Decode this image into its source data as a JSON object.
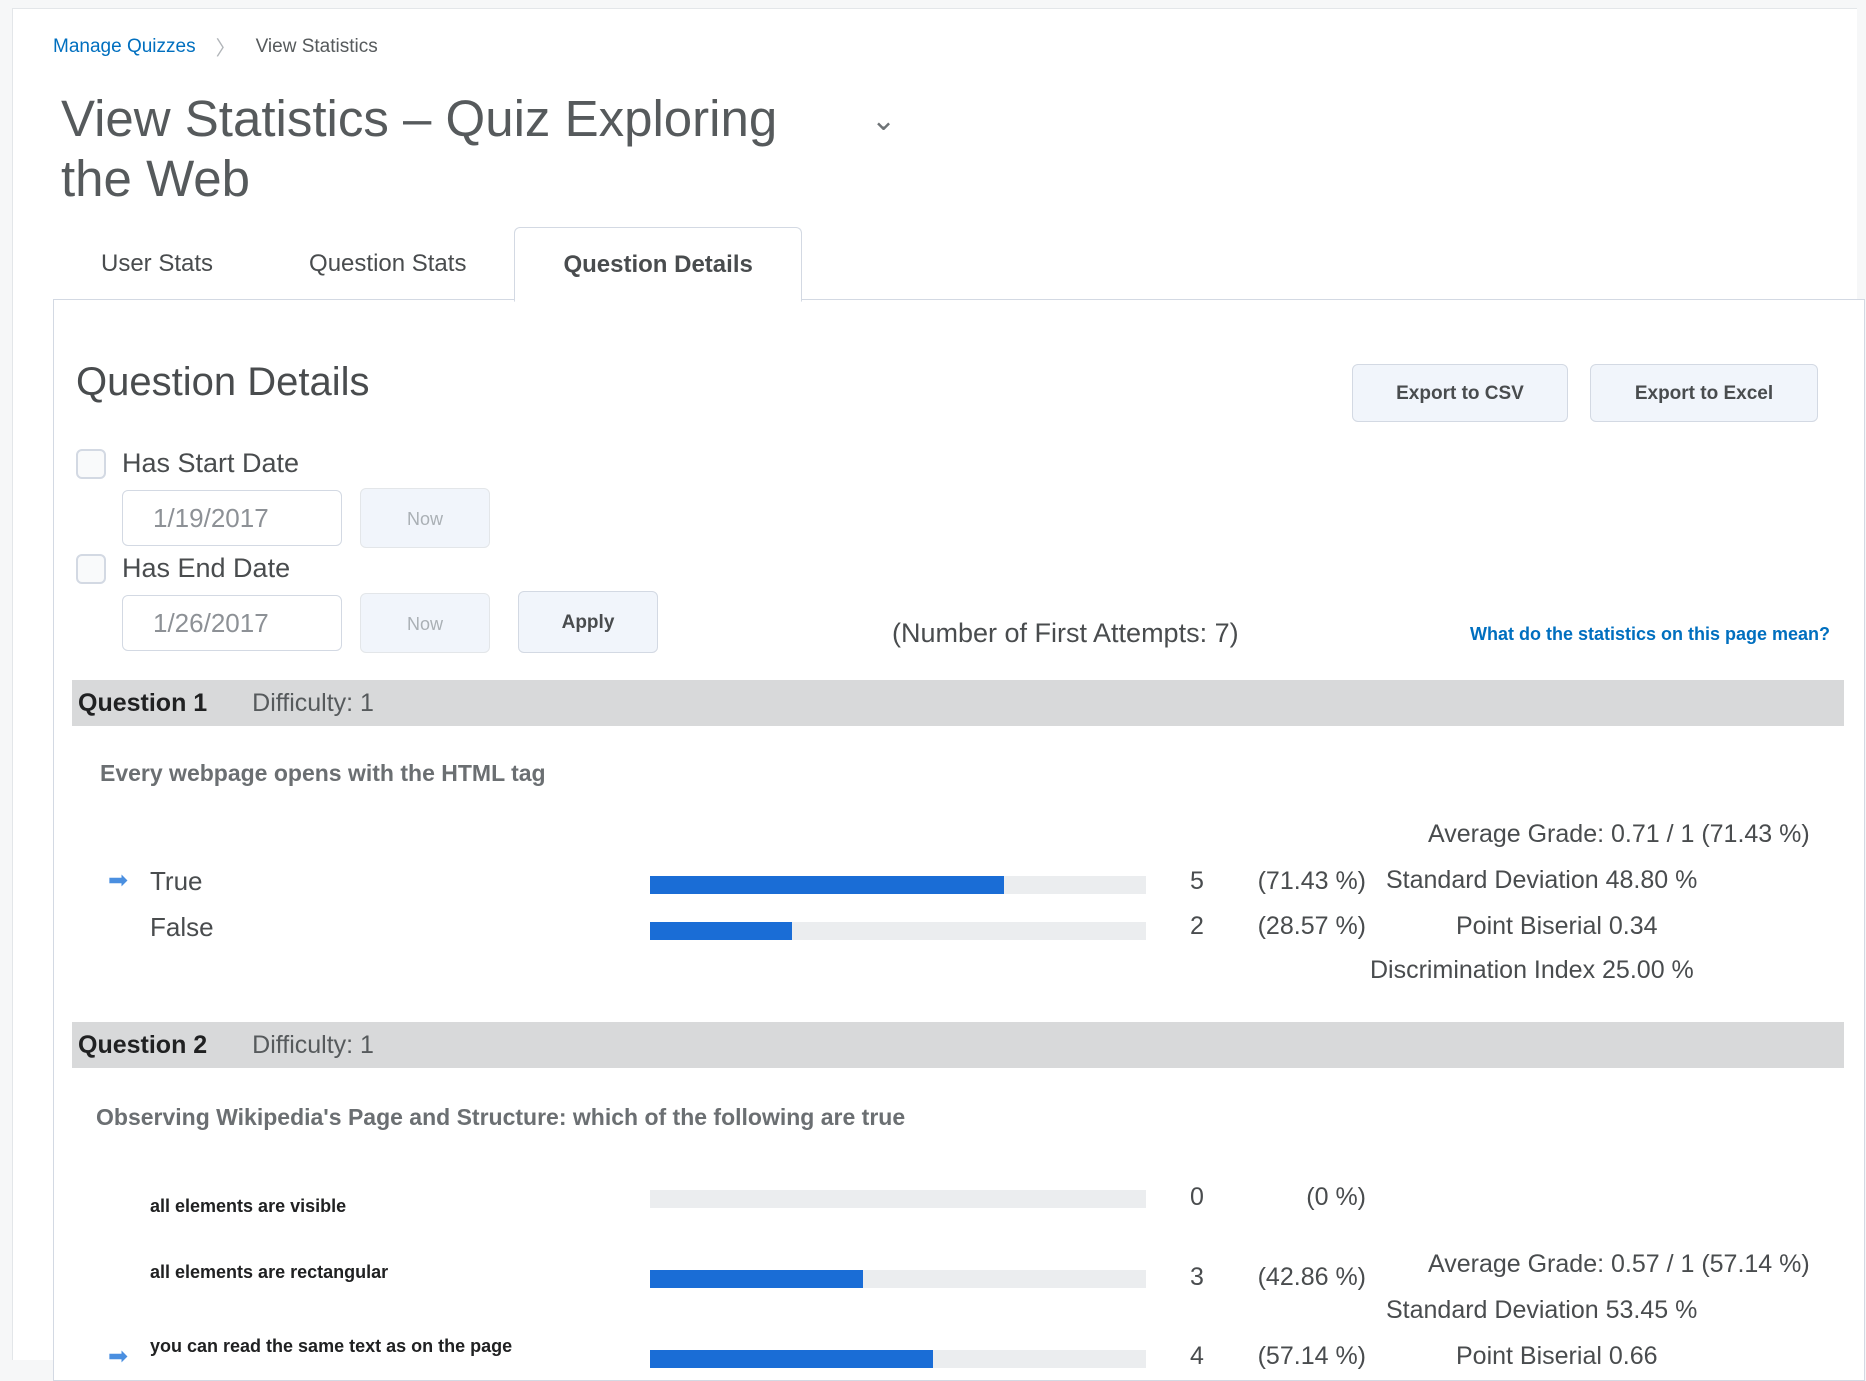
{
  "breadcrumb": {
    "parent": "Manage Quizzes",
    "separator": "〉",
    "current": "View Statistics"
  },
  "page": {
    "title": "View Statistics – Quiz Exploring the Web",
    "chevron": "⌄"
  },
  "tabs": [
    {
      "label": "User Stats",
      "active": false
    },
    {
      "label": "Question Stats",
      "active": false
    },
    {
      "label": "Question Details",
      "active": true
    }
  ],
  "panel": {
    "title": "Question Details",
    "export_csv": "Export to CSV",
    "export_excel": "Export to Excel",
    "start_date": {
      "label": "Has Start Date",
      "value": "1/19/2017",
      "now_label": "Now",
      "checked": false
    },
    "end_date": {
      "label": "Has End Date",
      "value": "1/26/2017",
      "now_label": "Now",
      "checked": false
    },
    "apply_label": "Apply",
    "first_attempts": "(Number of First Attempts: 7)",
    "help_link": "What do the statistics on this page mean?"
  },
  "questions": [
    {
      "number": "Question 1",
      "difficulty": "Difficulty: 1",
      "text": "Every webpage opens with the HTML tag",
      "answers": [
        {
          "label": "True",
          "correct": true,
          "count": "5",
          "percent": "(71.43 %)",
          "fraction": 0.7143
        },
        {
          "label": "False",
          "correct": false,
          "count": "2",
          "percent": "(28.57 %)",
          "fraction": 0.2857
        }
      ],
      "stats": {
        "average_grade": "Average Grade: 0.71 / 1 (71.43 %)",
        "std_dev": "Standard Deviation 48.80 %",
        "point_biserial": "Point Biserial 0.34",
        "discrimination": "Discrimination Index 25.00 %"
      }
    },
    {
      "number": "Question 2",
      "difficulty": "Difficulty: 1",
      "text": "Observing Wikipedia's Page and Structure: which of the following are true",
      "answers": [
        {
          "label": "all elements are visible",
          "correct": false,
          "count": "0",
          "percent": "(0 %)",
          "fraction": 0
        },
        {
          "label": "all elements are rectangular",
          "correct": false,
          "count": "3",
          "percent": "(42.86 %)",
          "fraction": 0.4286
        },
        {
          "label": "you can read the same text as on the page",
          "correct": true,
          "count": "4",
          "percent": "(57.14 %)",
          "fraction": 0.5714
        }
      ],
      "stats": {
        "average_grade": "Average Grade: 0.57 / 1 (57.14 %)",
        "std_dev": "Standard Deviation 53.45 %",
        "point_biserial": "Point Biserial 0.66"
      }
    }
  ],
  "colors": {
    "bar_fill": "#1a6dd6",
    "bar_track": "#ebedef",
    "link": "#006fbf",
    "header_bg": "#d8d9da"
  },
  "icons": {
    "correct_answer": "arrow-right-icon"
  }
}
